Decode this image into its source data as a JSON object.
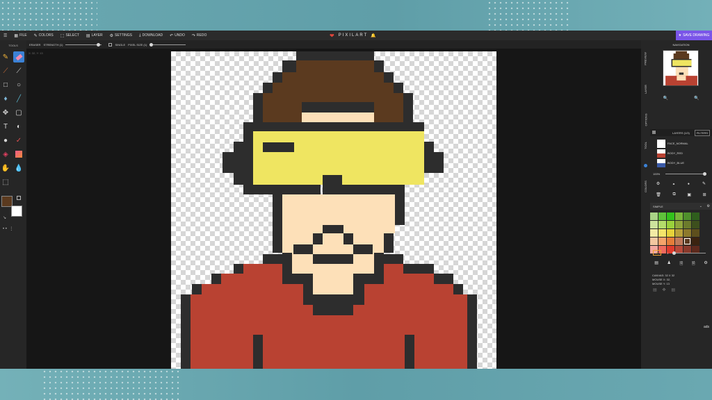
{
  "menu": [
    {
      "icon": "☰",
      "icon_name": "hamburger-icon",
      "label": ""
    },
    {
      "icon": "▦",
      "icon_name": "file-icon",
      "label": "FILE"
    },
    {
      "icon": "✎",
      "icon_name": "palette-icon",
      "label": "COLORS"
    },
    {
      "icon": "⬚",
      "icon_name": "select-icon",
      "label": "SELECT"
    },
    {
      "icon": "▤",
      "icon_name": "layer-icon",
      "label": "LAYER"
    },
    {
      "icon": "⚙",
      "icon_name": "settings-icon",
      "label": "SETTINGS"
    },
    {
      "icon": "⤓",
      "icon_name": "download-icon",
      "label": "DOWNLOAD"
    },
    {
      "icon": "↶",
      "icon_name": "undo-icon",
      "label": "UNDO"
    },
    {
      "icon": "↷",
      "icon_name": "redo-icon",
      "label": "REDO"
    }
  ],
  "brand": {
    "name": "PIXILART"
  },
  "save_button": {
    "label": "SAVE DRAWING"
  },
  "options": {
    "tool_name": "ERASER",
    "strength_label": "STRENGTH (1)",
    "single_label": "SINGLE",
    "pixel_size_label": "PIXEL SIZE (1)",
    "coords": "X: 32, Y: 13"
  },
  "toolbar": {
    "title": "TOOLS"
  },
  "side_tabs": [
    "PREVIEW",
    "LAYER",
    "OPTIONS",
    "TOOL",
    "COLORS"
  ],
  "navigation": {
    "title": "NAVIGATION"
  },
  "layers": {
    "header": "LAYERS (1/3)",
    "filters_label": "FILTERS",
    "items": [
      "FACE_NORMAL",
      "BODY_RED",
      "BODY_BLUE"
    ],
    "opacity": "100%"
  },
  "palette": {
    "name": "SIMPLE",
    "colors": [
      "#a9d486",
      "#5fc23b",
      "#33c21c",
      "#7ab53a",
      "#4f8f2c",
      "#2f5e1d",
      "#cde39d",
      "#b4dd6a",
      "#9ad13b",
      "#8fa53b",
      "#6c7b2c",
      "#3d4f1d",
      "#f3eba4",
      "#f4e56a",
      "#e6d23a",
      "#b8a13a",
      "#8d7a2c",
      "#5e4f1d",
      "#f4c7a0",
      "#f5a36a",
      "#e57d3a",
      "#c07a5a",
      "#5b3a1f",
      "#3b2310",
      "#f4a8a0",
      "#f06a5e",
      "#e03b2c",
      "#b84a3a",
      "#8a3a2c",
      "#5e2a1d"
    ],
    "selected_index": 22,
    "brush_size": "1"
  },
  "canvas_info": {
    "size": "CANVAS: 32 X 32",
    "mouse_x": "MOUSE X: 32,",
    "mouse_y": "MOUSE Y: 13"
  },
  "ads_label": "ads",
  "colors": {
    "primary": "#5b3a1f",
    "secondary": "#ffffff",
    "accent": "#3b82d6",
    "save": "#7a55e8"
  }
}
